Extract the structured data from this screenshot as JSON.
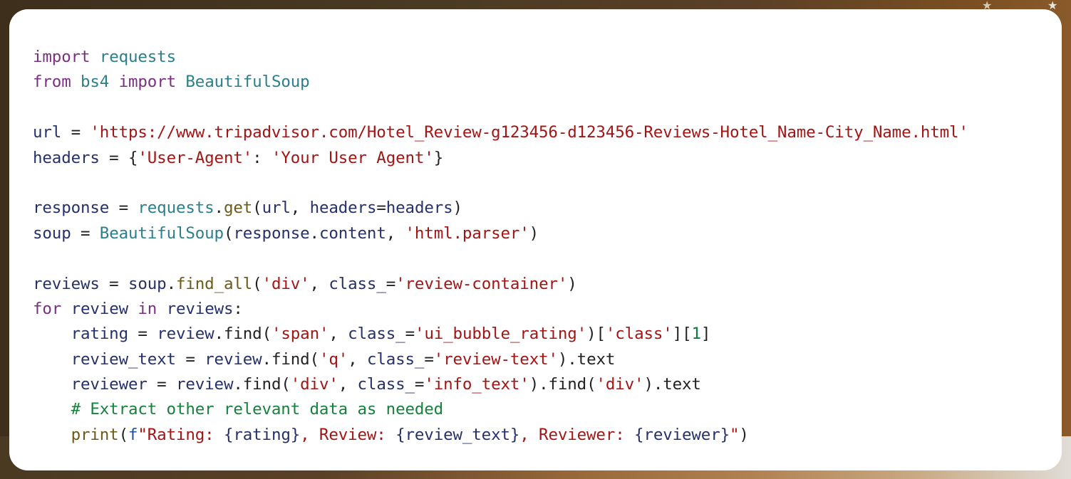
{
  "code": {
    "language": "python",
    "lines": [
      [
        {
          "t": "kw",
          "v": "import"
        },
        {
          "t": "pn",
          "v": " "
        },
        {
          "t": "mod",
          "v": "requests"
        }
      ],
      [
        {
          "t": "kw",
          "v": "from"
        },
        {
          "t": "pn",
          "v": " "
        },
        {
          "t": "mod",
          "v": "bs4"
        },
        {
          "t": "pn",
          "v": " "
        },
        {
          "t": "kw",
          "v": "import"
        },
        {
          "t": "pn",
          "v": " "
        },
        {
          "t": "mod",
          "v": "BeautifulSoup"
        }
      ],
      [],
      [
        {
          "t": "var",
          "v": "url"
        },
        {
          "t": "pn",
          "v": " = "
        },
        {
          "t": "str",
          "v": "'https://www.tripadvisor.com/Hotel_Review-g123456-d123456-Reviews-Hotel_Name-City_Name.html'"
        }
      ],
      [
        {
          "t": "var",
          "v": "headers"
        },
        {
          "t": "pn",
          "v": " = {"
        },
        {
          "t": "str",
          "v": "'User-Agent'"
        },
        {
          "t": "pn",
          "v": ": "
        },
        {
          "t": "str",
          "v": "'Your User Agent'"
        },
        {
          "t": "pn",
          "v": "}"
        }
      ],
      [],
      [
        {
          "t": "var",
          "v": "response"
        },
        {
          "t": "pn",
          "v": " = "
        },
        {
          "t": "mod",
          "v": "requests"
        },
        {
          "t": "pn",
          "v": "."
        },
        {
          "t": "fn",
          "v": "get"
        },
        {
          "t": "pn",
          "v": "("
        },
        {
          "t": "var",
          "v": "url"
        },
        {
          "t": "pn",
          "v": ", "
        },
        {
          "t": "var",
          "v": "headers"
        },
        {
          "t": "pn",
          "v": "="
        },
        {
          "t": "var",
          "v": "headers"
        },
        {
          "t": "pn",
          "v": ")"
        }
      ],
      [
        {
          "t": "var",
          "v": "soup"
        },
        {
          "t": "pn",
          "v": " = "
        },
        {
          "t": "mod",
          "v": "BeautifulSoup"
        },
        {
          "t": "pn",
          "v": "("
        },
        {
          "t": "var",
          "v": "response"
        },
        {
          "t": "pn",
          "v": "."
        },
        {
          "t": "var",
          "v": "content"
        },
        {
          "t": "pn",
          "v": ", "
        },
        {
          "t": "str",
          "v": "'html.parser'"
        },
        {
          "t": "pn",
          "v": ")"
        }
      ],
      [],
      [
        {
          "t": "var",
          "v": "reviews"
        },
        {
          "t": "pn",
          "v": " = "
        },
        {
          "t": "var",
          "v": "soup"
        },
        {
          "t": "pn",
          "v": "."
        },
        {
          "t": "fn",
          "v": "find_all"
        },
        {
          "t": "pn",
          "v": "("
        },
        {
          "t": "str",
          "v": "'div'"
        },
        {
          "t": "pn",
          "v": ", "
        },
        {
          "t": "var",
          "v": "class_"
        },
        {
          "t": "pn",
          "v": "="
        },
        {
          "t": "str",
          "v": "'review-container'"
        },
        {
          "t": "pn",
          "v": ")"
        }
      ],
      [
        {
          "t": "kw",
          "v": "for"
        },
        {
          "t": "pn",
          "v": " "
        },
        {
          "t": "var",
          "v": "review"
        },
        {
          "t": "pn",
          "v": " "
        },
        {
          "t": "kw",
          "v": "in"
        },
        {
          "t": "pn",
          "v": " "
        },
        {
          "t": "var",
          "v": "reviews"
        },
        {
          "t": "pn",
          "v": ":"
        }
      ],
      [
        {
          "t": "pn",
          "v": "    "
        },
        {
          "t": "var",
          "v": "rating"
        },
        {
          "t": "pn",
          "v": " = "
        },
        {
          "t": "var",
          "v": "review"
        },
        {
          "t": "pn",
          "v": "."
        },
        {
          "t": "pn",
          "v": "find"
        },
        {
          "t": "pn",
          "v": "("
        },
        {
          "t": "str",
          "v": "'span'"
        },
        {
          "t": "pn",
          "v": ", "
        },
        {
          "t": "var",
          "v": "class_"
        },
        {
          "t": "pn",
          "v": "="
        },
        {
          "t": "str",
          "v": "'ui_bubble_rating'"
        },
        {
          "t": "pn",
          "v": ")["
        },
        {
          "t": "str",
          "v": "'class'"
        },
        {
          "t": "pn",
          "v": "]["
        },
        {
          "t": "num",
          "v": "1"
        },
        {
          "t": "pn",
          "v": "]"
        }
      ],
      [
        {
          "t": "pn",
          "v": "    "
        },
        {
          "t": "var",
          "v": "review_text"
        },
        {
          "t": "pn",
          "v": " = "
        },
        {
          "t": "var",
          "v": "review"
        },
        {
          "t": "pn",
          "v": ".find("
        },
        {
          "t": "str",
          "v": "'q'"
        },
        {
          "t": "pn",
          "v": ", "
        },
        {
          "t": "var",
          "v": "class_"
        },
        {
          "t": "pn",
          "v": "="
        },
        {
          "t": "str",
          "v": "'review-text'"
        },
        {
          "t": "pn",
          "v": ").text"
        }
      ],
      [
        {
          "t": "pn",
          "v": "    "
        },
        {
          "t": "var",
          "v": "reviewer"
        },
        {
          "t": "pn",
          "v": " = "
        },
        {
          "t": "var",
          "v": "review"
        },
        {
          "t": "pn",
          "v": ".find("
        },
        {
          "t": "str",
          "v": "'div'"
        },
        {
          "t": "pn",
          "v": ", "
        },
        {
          "t": "var",
          "v": "class_"
        },
        {
          "t": "pn",
          "v": "="
        },
        {
          "t": "str",
          "v": "'info_text'"
        },
        {
          "t": "pn",
          "v": ").find("
        },
        {
          "t": "str",
          "v": "'div'"
        },
        {
          "t": "pn",
          "v": ").text"
        }
      ],
      [
        {
          "t": "pn",
          "v": "    "
        },
        {
          "t": "cm",
          "v": "# Extract other relevant data as needed"
        }
      ],
      [
        {
          "t": "pn",
          "v": "    "
        },
        {
          "t": "fn",
          "v": "print"
        },
        {
          "t": "pn",
          "v": "("
        },
        {
          "t": "fs",
          "v": "f"
        },
        {
          "t": "str",
          "v": "\"Rating: "
        },
        {
          "t": "var",
          "v": "{rating}"
        },
        {
          "t": "str",
          "v": ", Review: "
        },
        {
          "t": "var",
          "v": "{review_text}"
        },
        {
          "t": "str",
          "v": ", Reviewer: "
        },
        {
          "t": "var",
          "v": "{reviewer}"
        },
        {
          "t": "str",
          "v": "\""
        },
        {
          "t": "pn",
          "v": ")"
        }
      ]
    ]
  },
  "background": {
    "decorations": [
      "star-icon",
      "star-icon"
    ]
  }
}
